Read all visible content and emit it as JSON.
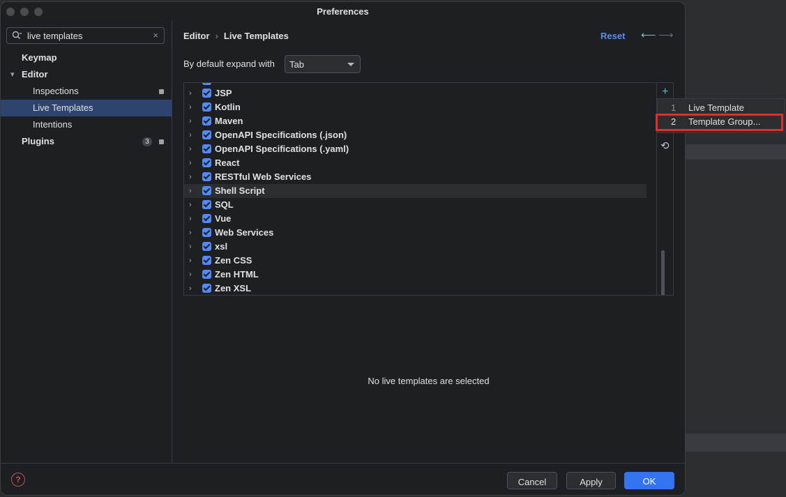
{
  "window": {
    "title": "Preferences"
  },
  "search": {
    "value": "live templates",
    "clear": "×"
  },
  "sidebar": {
    "items": [
      {
        "label": "Keymap"
      },
      {
        "label": "Editor"
      },
      {
        "label": "Inspections"
      },
      {
        "label": "Live Templates"
      },
      {
        "label": "Intentions"
      },
      {
        "label": "Plugins",
        "badge": "3"
      }
    ]
  },
  "main": {
    "breadcrumb": {
      "parent": "Editor",
      "sep": "›",
      "current": "Live Templates"
    },
    "reset_label": "Reset",
    "expand_label": "By default expand with",
    "expand_value": "Tab",
    "tree": [
      {
        "label": "JSP"
      },
      {
        "label": "Kotlin"
      },
      {
        "label": "Maven"
      },
      {
        "label": "OpenAPI Specifications (.json)"
      },
      {
        "label": "OpenAPI Specifications (.yaml)"
      },
      {
        "label": "React"
      },
      {
        "label": "RESTful Web Services"
      },
      {
        "label": "Shell Script"
      },
      {
        "label": "SQL"
      },
      {
        "label": "Vue"
      },
      {
        "label": "Web Services"
      },
      {
        "label": "xsl"
      },
      {
        "label": "Zen CSS"
      },
      {
        "label": "Zen HTML"
      },
      {
        "label": "Zen XSL"
      }
    ],
    "empty_message": "No live templates are selected"
  },
  "popup": {
    "items": [
      {
        "num": "1",
        "label": "Live Template"
      },
      {
        "num": "2",
        "label": "Template Group..."
      }
    ]
  },
  "footer": {
    "help": "?",
    "cancel": "Cancel",
    "apply": "Apply",
    "ok": "OK"
  },
  "colors": {
    "accent": "#3574f0",
    "selection": "#2e436e",
    "highlight_box": "#e32d27",
    "checkbox": "#548af7"
  }
}
